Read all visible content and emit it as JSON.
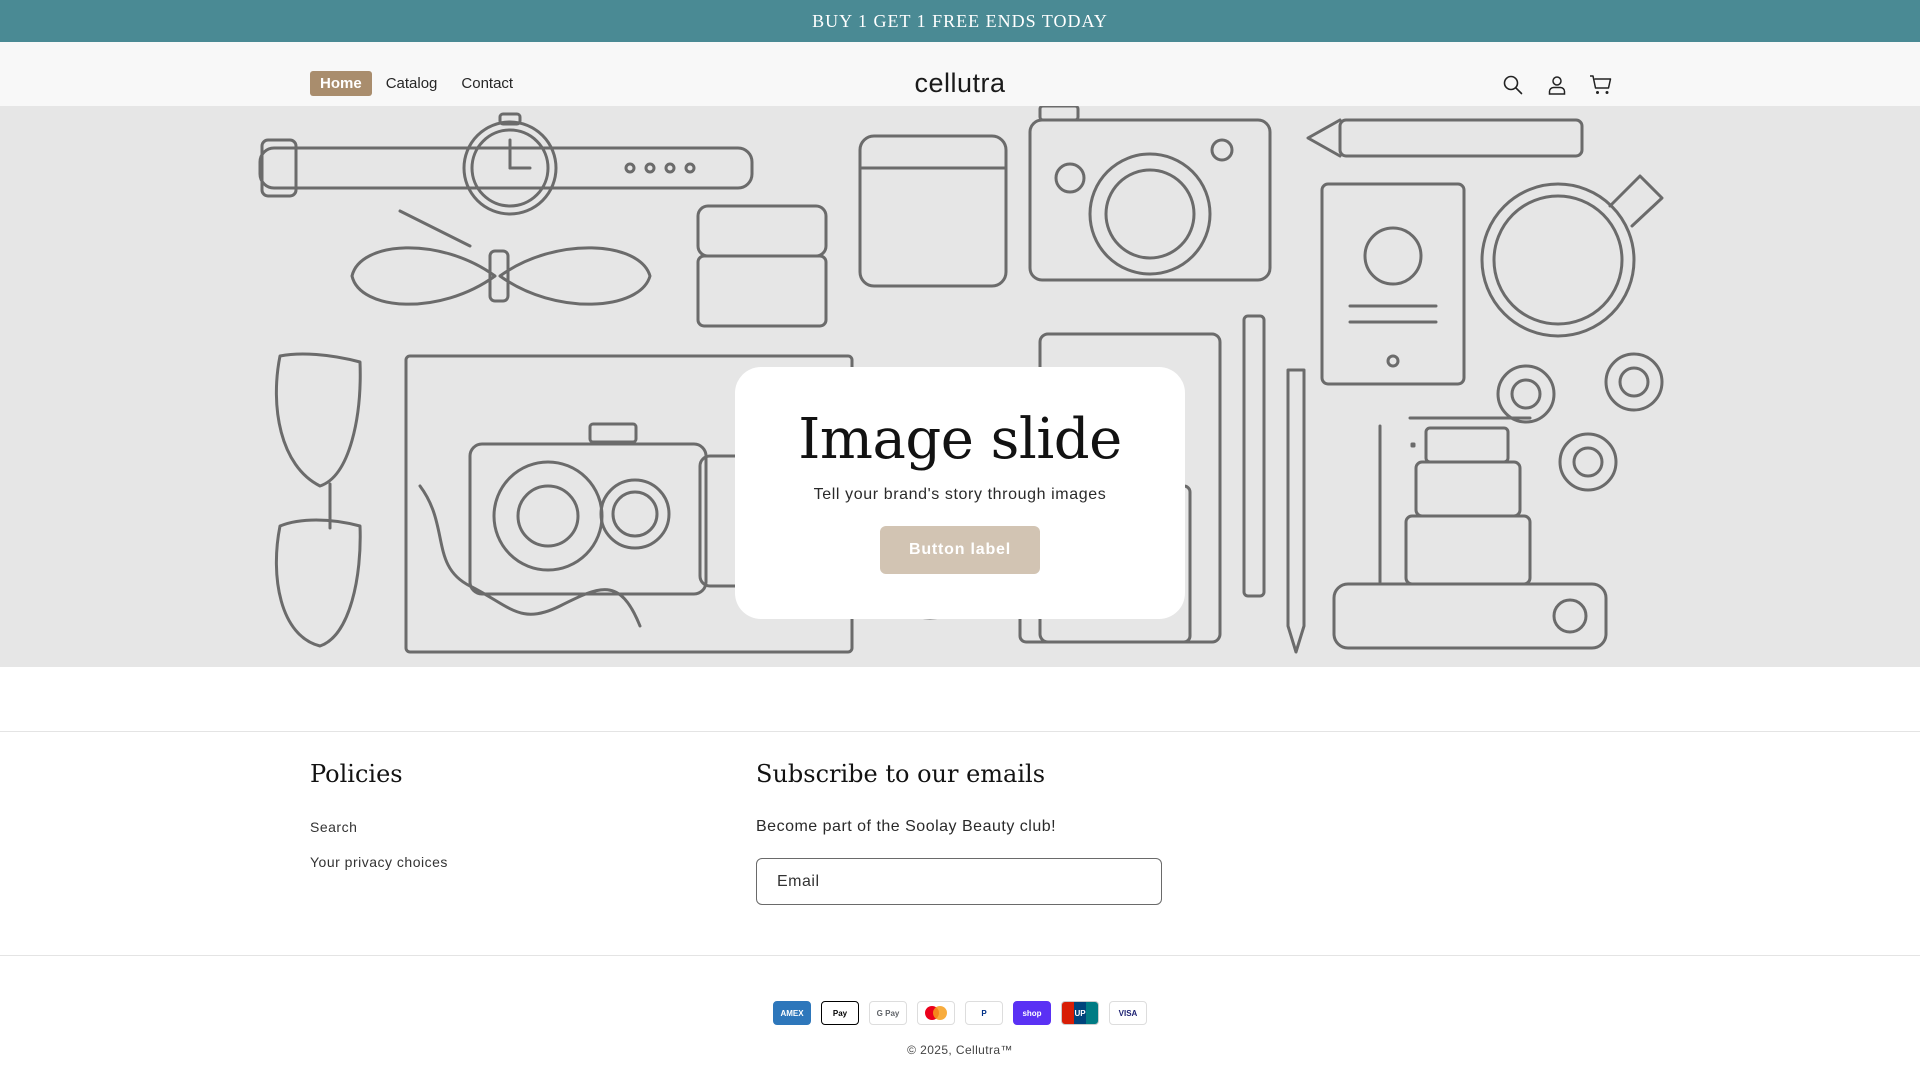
{
  "announcement": {
    "text": "BUY 1 GET 1 FREE ENDS TODAY"
  },
  "header": {
    "logo": "cellutra",
    "nav": [
      {
        "label": "Home",
        "active": true
      },
      {
        "label": "Catalog",
        "active": false
      },
      {
        "label": "Contact",
        "active": false
      }
    ],
    "icons": [
      "search-icon",
      "account-icon",
      "cart-icon"
    ]
  },
  "hero": {
    "title": "Image slide",
    "subtitle": "Tell your brand's story through images",
    "button_label": "Button label"
  },
  "footer": {
    "policies": {
      "title": "Policies",
      "links": [
        "Search",
        "Your privacy choices"
      ]
    },
    "subscribe": {
      "title": "Subscribe to our emails",
      "text": "Become part of the Soolay Beauty club!",
      "email_placeholder": "Email"
    },
    "payments": [
      {
        "name": "American Express",
        "label": "AMEX",
        "color": "#2e77bb"
      },
      {
        "name": "Apple Pay",
        "label": "Pay",
        "color": "#000000"
      },
      {
        "name": "Google Pay",
        "label": "G Pay",
        "color": "#5f6368"
      },
      {
        "name": "Mastercard",
        "label": "MC",
        "color": "#eb001b"
      },
      {
        "name": "PayPal",
        "label": "P",
        "color": "#003087"
      },
      {
        "name": "Shop Pay",
        "label": "shop",
        "color": "#5a31f4"
      },
      {
        "name": "UnionPay",
        "label": "UP",
        "color": "#d81e06"
      },
      {
        "name": "Visa",
        "label": "VISA",
        "color": "#1a1f71"
      }
    ],
    "copyright": "© 2025, Cellutra™"
  },
  "colors": {
    "announcement_bg": "#4a8a94",
    "nav_active_bg": "#a98d6d",
    "hero_button_bg": "#d2c4b3",
    "hero_bg": "#e6e6e6"
  }
}
